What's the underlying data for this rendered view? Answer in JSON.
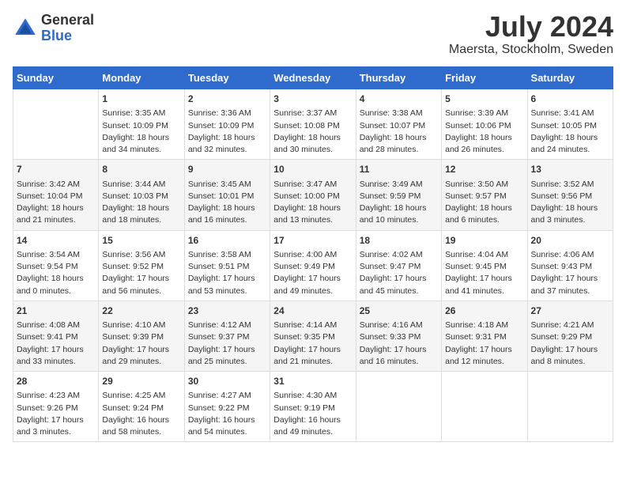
{
  "logo": {
    "general": "General",
    "blue": "Blue"
  },
  "title": {
    "month_year": "July 2024",
    "location": "Maersta, Stockholm, Sweden"
  },
  "days_of_week": [
    "Sunday",
    "Monday",
    "Tuesday",
    "Wednesday",
    "Thursday",
    "Friday",
    "Saturday"
  ],
  "weeks": [
    [
      {
        "day": "",
        "content": ""
      },
      {
        "day": "1",
        "content": "Sunrise: 3:35 AM\nSunset: 10:09 PM\nDaylight: 18 hours\nand 34 minutes."
      },
      {
        "day": "2",
        "content": "Sunrise: 3:36 AM\nSunset: 10:09 PM\nDaylight: 18 hours\nand 32 minutes."
      },
      {
        "day": "3",
        "content": "Sunrise: 3:37 AM\nSunset: 10:08 PM\nDaylight: 18 hours\nand 30 minutes."
      },
      {
        "day": "4",
        "content": "Sunrise: 3:38 AM\nSunset: 10:07 PM\nDaylight: 18 hours\nand 28 minutes."
      },
      {
        "day": "5",
        "content": "Sunrise: 3:39 AM\nSunset: 10:06 PM\nDaylight: 18 hours\nand 26 minutes."
      },
      {
        "day": "6",
        "content": "Sunrise: 3:41 AM\nSunset: 10:05 PM\nDaylight: 18 hours\nand 24 minutes."
      }
    ],
    [
      {
        "day": "7",
        "content": "Sunrise: 3:42 AM\nSunset: 10:04 PM\nDaylight: 18 hours\nand 21 minutes."
      },
      {
        "day": "8",
        "content": "Sunrise: 3:44 AM\nSunset: 10:03 PM\nDaylight: 18 hours\nand 18 minutes."
      },
      {
        "day": "9",
        "content": "Sunrise: 3:45 AM\nSunset: 10:01 PM\nDaylight: 18 hours\nand 16 minutes."
      },
      {
        "day": "10",
        "content": "Sunrise: 3:47 AM\nSunset: 10:00 PM\nDaylight: 18 hours\nand 13 minutes."
      },
      {
        "day": "11",
        "content": "Sunrise: 3:49 AM\nSunset: 9:59 PM\nDaylight: 18 hours\nand 10 minutes."
      },
      {
        "day": "12",
        "content": "Sunrise: 3:50 AM\nSunset: 9:57 PM\nDaylight: 18 hours\nand 6 minutes."
      },
      {
        "day": "13",
        "content": "Sunrise: 3:52 AM\nSunset: 9:56 PM\nDaylight: 18 hours\nand 3 minutes."
      }
    ],
    [
      {
        "day": "14",
        "content": "Sunrise: 3:54 AM\nSunset: 9:54 PM\nDaylight: 18 hours\nand 0 minutes."
      },
      {
        "day": "15",
        "content": "Sunrise: 3:56 AM\nSunset: 9:52 PM\nDaylight: 17 hours\nand 56 minutes."
      },
      {
        "day": "16",
        "content": "Sunrise: 3:58 AM\nSunset: 9:51 PM\nDaylight: 17 hours\nand 53 minutes."
      },
      {
        "day": "17",
        "content": "Sunrise: 4:00 AM\nSunset: 9:49 PM\nDaylight: 17 hours\nand 49 minutes."
      },
      {
        "day": "18",
        "content": "Sunrise: 4:02 AM\nSunset: 9:47 PM\nDaylight: 17 hours\nand 45 minutes."
      },
      {
        "day": "19",
        "content": "Sunrise: 4:04 AM\nSunset: 9:45 PM\nDaylight: 17 hours\nand 41 minutes."
      },
      {
        "day": "20",
        "content": "Sunrise: 4:06 AM\nSunset: 9:43 PM\nDaylight: 17 hours\nand 37 minutes."
      }
    ],
    [
      {
        "day": "21",
        "content": "Sunrise: 4:08 AM\nSunset: 9:41 PM\nDaylight: 17 hours\nand 33 minutes."
      },
      {
        "day": "22",
        "content": "Sunrise: 4:10 AM\nSunset: 9:39 PM\nDaylight: 17 hours\nand 29 minutes."
      },
      {
        "day": "23",
        "content": "Sunrise: 4:12 AM\nSunset: 9:37 PM\nDaylight: 17 hours\nand 25 minutes."
      },
      {
        "day": "24",
        "content": "Sunrise: 4:14 AM\nSunset: 9:35 PM\nDaylight: 17 hours\nand 21 minutes."
      },
      {
        "day": "25",
        "content": "Sunrise: 4:16 AM\nSunset: 9:33 PM\nDaylight: 17 hours\nand 16 minutes."
      },
      {
        "day": "26",
        "content": "Sunrise: 4:18 AM\nSunset: 9:31 PM\nDaylight: 17 hours\nand 12 minutes."
      },
      {
        "day": "27",
        "content": "Sunrise: 4:21 AM\nSunset: 9:29 PM\nDaylight: 17 hours\nand 8 minutes."
      }
    ],
    [
      {
        "day": "28",
        "content": "Sunrise: 4:23 AM\nSunset: 9:26 PM\nDaylight: 17 hours\nand 3 minutes."
      },
      {
        "day": "29",
        "content": "Sunrise: 4:25 AM\nSunset: 9:24 PM\nDaylight: 16 hours\nand 58 minutes."
      },
      {
        "day": "30",
        "content": "Sunrise: 4:27 AM\nSunset: 9:22 PM\nDaylight: 16 hours\nand 54 minutes."
      },
      {
        "day": "31",
        "content": "Sunrise: 4:30 AM\nSunset: 9:19 PM\nDaylight: 16 hours\nand 49 minutes."
      },
      {
        "day": "",
        "content": ""
      },
      {
        "day": "",
        "content": ""
      },
      {
        "day": "",
        "content": ""
      }
    ]
  ]
}
